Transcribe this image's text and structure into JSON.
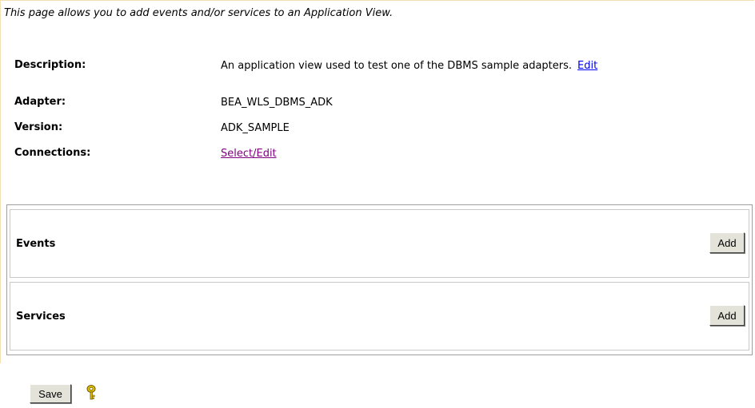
{
  "intro": "This page allows you to add events and/or services to an Application View.",
  "properties": {
    "description": {
      "label": "Description:",
      "value": "An application view used to test one of the DBMS sample adapters.",
      "edit_link": "Edit"
    },
    "adapter": {
      "label": "Adapter:",
      "value": "BEA_WLS_DBMS_ADK"
    },
    "version": {
      "label": "Version:",
      "value": "ADK_SAMPLE"
    },
    "connections": {
      "label": "Connections:",
      "link": "Select/Edit"
    }
  },
  "events": {
    "title": "Events",
    "add_label": "Add"
  },
  "services": {
    "title": "Services",
    "add_label": "Add"
  },
  "footer": {
    "save_label": "Save",
    "help_icon": "help-key-icon"
  },
  "colors": {
    "link": "#0000ee",
    "visited_link": "#800080",
    "button_face": "#e3e3d9",
    "help_icon": "#e6c200"
  }
}
